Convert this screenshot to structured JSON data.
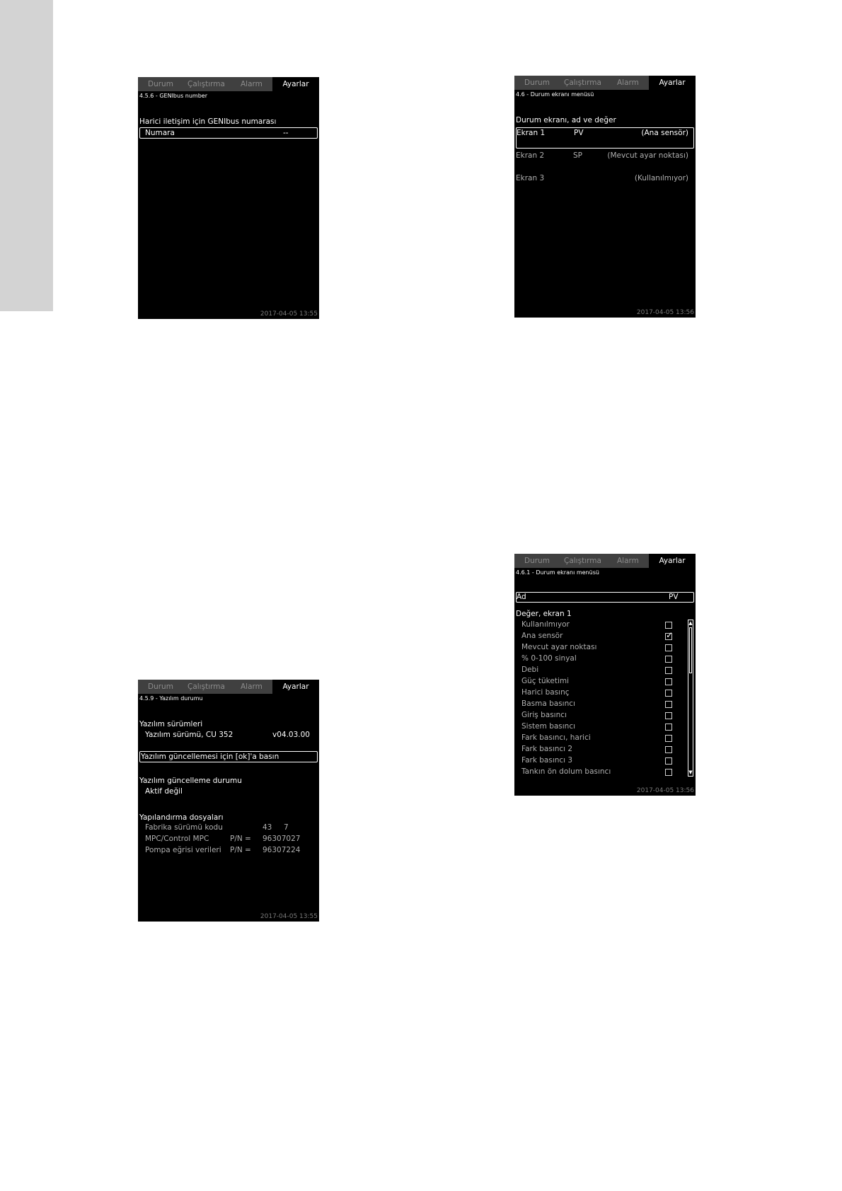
{
  "tabs": [
    "Durum",
    "Çalıştırma",
    "Alarm",
    "Ayarlar"
  ],
  "screen_genibus": {
    "breadcrumb": "4.5.6 - GENIbus number",
    "heading": "Harici iletişim için GENIbus numarası",
    "field_label": "Numara",
    "field_value": "--",
    "timestamp": "2017-04-05  13:55"
  },
  "screen_status_menu": {
    "breadcrumb": "4.6 - Durum ekranı menüsü",
    "heading": "Durum ekranı, ad ve değer",
    "rows": [
      {
        "screen": "Ekran 1",
        "name": "PV",
        "value": "(Ana sensör)"
      },
      {
        "screen": "Ekran 2",
        "name": "SP",
        "value": "(Mevcut ayar noktası)"
      },
      {
        "screen": "Ekran 3",
        "name": "",
        "value": "(Kullanılmıyor)"
      }
    ],
    "timestamp": "2017-04-05  13:56"
  },
  "screen_software": {
    "breadcrumb": "4.5.9 - Yazılım durumu",
    "versions_heading": "Yazılım sürümleri",
    "version_label": "Yazılım sürümü, CU 352",
    "version_value": "v04.03.00",
    "update_prompt": "Yazılım güncellemesi için [ok]'a basın",
    "update_status_heading": "Yazılım güncelleme durumu",
    "update_status_value": "Aktif değil",
    "config_heading": "Yapılandırma dosyaları",
    "config_rows": [
      {
        "label": "Fabrika sürümü kodu",
        "pn": "",
        "value": "43     7"
      },
      {
        "label": "MPC/Control MPC",
        "pn": "P/N =",
        "value": "96307027"
      },
      {
        "label": "Pompa eğrisi verileri",
        "pn": "P/N =",
        "value": "96307224"
      }
    ],
    "timestamp": "2017-04-05  13:55"
  },
  "screen_status_value": {
    "breadcrumb": "4.6.1 - Durum ekranı menüsü",
    "name_label": "Ad",
    "name_value": "PV",
    "list_heading": "Değer, ekran 1",
    "options": [
      {
        "label": "Kullanılmıyor",
        "checked": false
      },
      {
        "label": "Ana sensör",
        "checked": true
      },
      {
        "label": "Mevcut ayar noktası",
        "checked": false
      },
      {
        "label": "% 0-100 sinyal",
        "checked": false
      },
      {
        "label": "Debi",
        "checked": false
      },
      {
        "label": "Güç tüketimi",
        "checked": false
      },
      {
        "label": "Harici basınç",
        "checked": false
      },
      {
        "label": "Basma basıncı",
        "checked": false
      },
      {
        "label": "Giriş basıncı",
        "checked": false
      },
      {
        "label": "Sistem basıncı",
        "checked": false
      },
      {
        "label": "Fark basıncı, harici",
        "checked": false
      },
      {
        "label": "Fark basıncı 2",
        "checked": false
      },
      {
        "label": "Fark basıncı 3",
        "checked": false
      },
      {
        "label": "Tankın ön dolum basıncı",
        "checked": false
      }
    ],
    "timestamp": "2017-04-05  13:56"
  }
}
